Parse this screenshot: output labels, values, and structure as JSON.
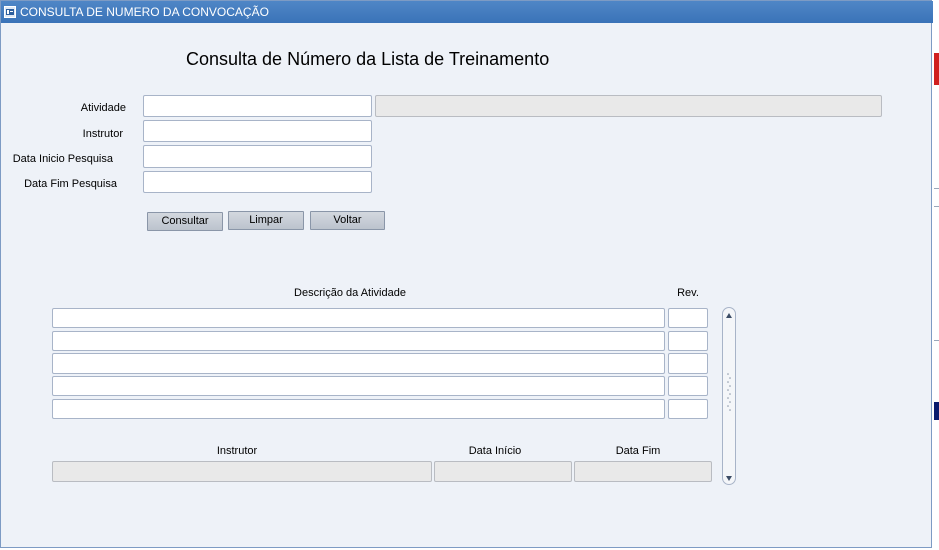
{
  "window": {
    "title": "CONSULTA DE NUMERO DA CONVOCAÇÃO",
    "icon": "app-window-icon"
  },
  "form": {
    "heading": "Consulta de Número da Lista de Treinamento",
    "fields": {
      "atividade": {
        "label": "Atividade",
        "value": "",
        "description": ""
      },
      "instrutor": {
        "label": "Instrutor",
        "value": ""
      },
      "data_inicio": {
        "label": "Data Inicio Pesquisa",
        "value": ""
      },
      "data_fim": {
        "label": "Data Fim Pesquisa",
        "value": ""
      }
    },
    "buttons": {
      "consultar": "Consultar",
      "limpar": "Limpar",
      "voltar": "Voltar"
    }
  },
  "results": {
    "headers": {
      "descricao": "Descrição da Atividade",
      "rev": "Rev."
    },
    "rows": [
      {
        "descricao": "",
        "rev": ""
      },
      {
        "descricao": "",
        "rev": ""
      },
      {
        "descricao": "",
        "rev": ""
      },
      {
        "descricao": "",
        "rev": ""
      },
      {
        "descricao": "",
        "rev": ""
      }
    ],
    "detail_headers": {
      "instrutor": "Instrutor",
      "data_inicio": "Data Início",
      "data_fim": "Data Fim"
    },
    "detail": {
      "instrutor": "",
      "data_inicio": "",
      "data_fim": ""
    }
  },
  "colors": {
    "titlebar": "#3a73b8",
    "window_bg": "#eef2f8",
    "field_border": "#a8b4c8",
    "readonly_bg": "#e9e9e9",
    "button_bg": "#c8ced6"
  }
}
